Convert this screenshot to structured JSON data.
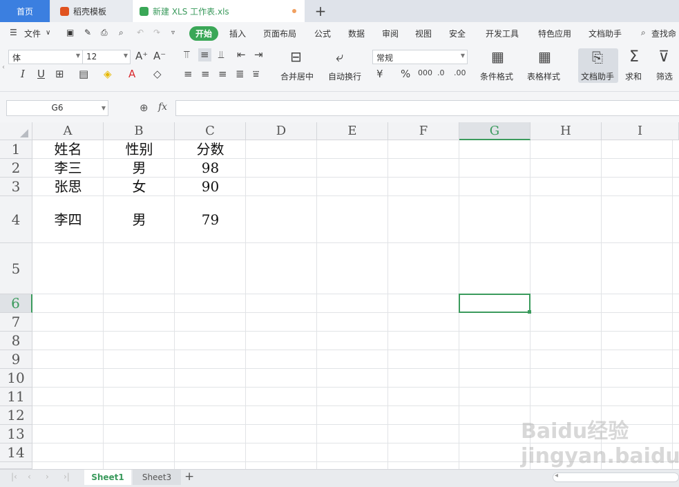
{
  "tabs": {
    "home": "首页",
    "template": "稻壳模板",
    "file": "新建 XLS 工作表.xls",
    "add": "+"
  },
  "ribbon": {
    "menu": "文件",
    "tabs": [
      "开始",
      "插入",
      "页面布局",
      "公式",
      "数据",
      "审阅",
      "视图",
      "安全",
      "开发工具",
      "特色应用",
      "文档助手"
    ],
    "search": "查找命"
  },
  "toolbar": {
    "font_name": "体",
    "font_size": "12",
    "number_format": "常规",
    "merge": "合并居中",
    "wrap": "自动换行",
    "cond_format": "条件格式",
    "table_style": "表格样式",
    "doc_assist": "文档助手",
    "sum": "求和",
    "filter": "筛选"
  },
  "formula": {
    "cell_ref": "G6",
    "fx": "fx",
    "value": ""
  },
  "grid": {
    "columns": [
      "A",
      "B",
      "C",
      "D",
      "E",
      "F",
      "G",
      "H",
      "I"
    ],
    "selected_column": "G",
    "rows": [
      "1",
      "2",
      "3",
      "4",
      "5",
      "6",
      "7",
      "8",
      "9",
      "10",
      "11",
      "12",
      "13",
      "14"
    ],
    "selected_row": "6",
    "cells": {
      "A1": "姓名",
      "B1": "性别",
      "C1": "分数",
      "A2": "李三",
      "B2": "男",
      "C2": "98",
      "A3": "张思",
      "B3": "女",
      "C3": "90",
      "A4": "李四",
      "B4": "男",
      "C4": "79"
    }
  },
  "sheets": {
    "active": "Sheet1",
    "other": "Sheet3",
    "add": "+"
  },
  "watermark": "Baidu经验 jingyan.baidu.com",
  "colors": {
    "accent_green": "#3aa757",
    "home_tab_blue": "#3b7fe0"
  }
}
